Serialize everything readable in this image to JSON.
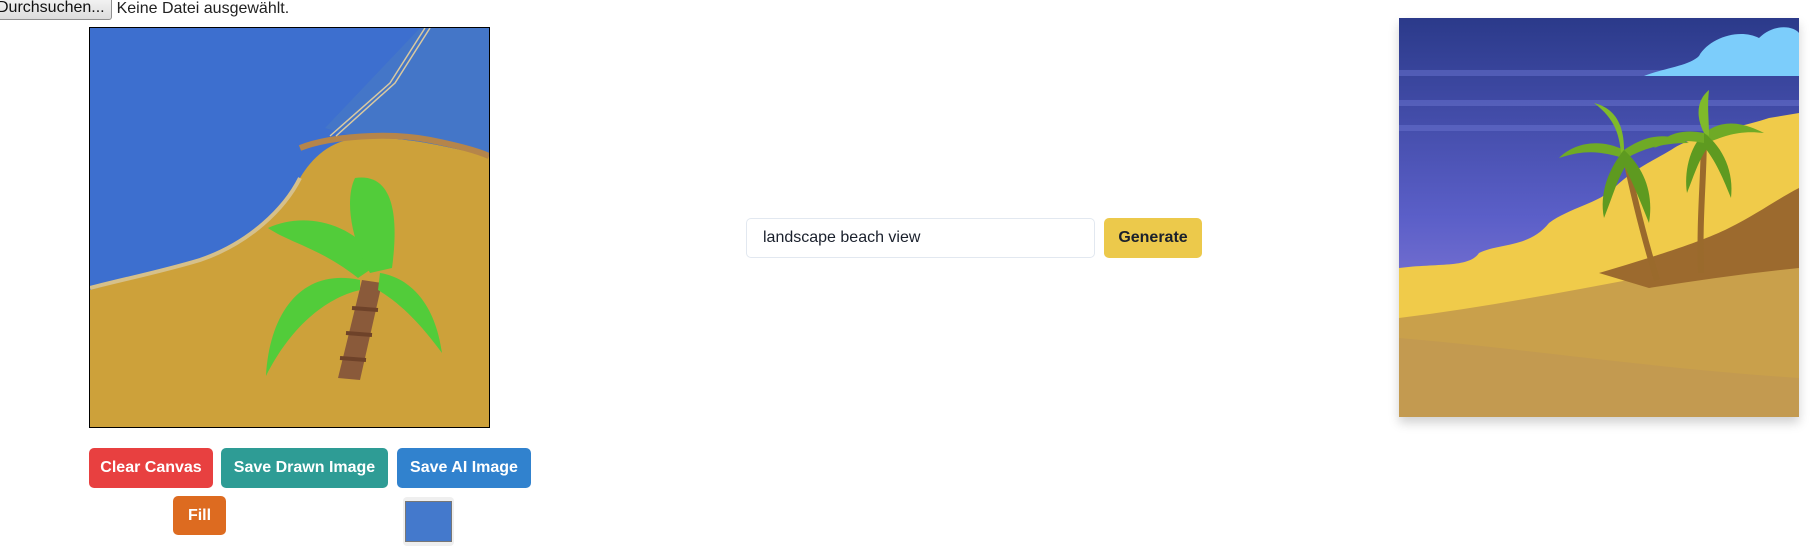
{
  "file_input": {
    "button_label": "Durchsuchen...",
    "status_text": "Keine Datei ausgewählt."
  },
  "toolbar": {
    "clear_label": "Clear Canvas",
    "save_drawn_label": "Save Drawn Image",
    "save_ai_label": "Save AI Image",
    "fill_label": "Fill",
    "color_value": "#4479cc"
  },
  "prompt": {
    "value": "landscape beach view",
    "generate_label": "Generate"
  },
  "colors": {
    "clear": "#e84040",
    "save_drawn": "#2e9c95",
    "save_ai": "#3182ce",
    "fill": "#dd6b20",
    "generate": "#ecc94b",
    "swatch": "#4479cc"
  }
}
